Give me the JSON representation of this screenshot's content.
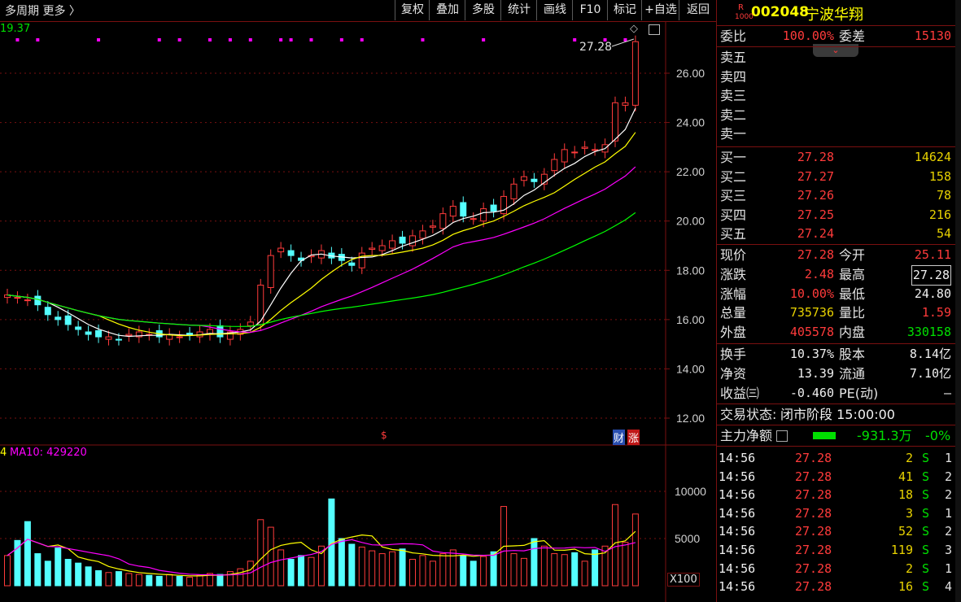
{
  "toolbar": {
    "period_label": "多周期  更多 〉",
    "buttons": [
      "复权",
      "叠加",
      "多股",
      "统计",
      "画线",
      "F10",
      "标记",
      "+自选",
      "返回"
    ]
  },
  "stock": {
    "badge_top": "R",
    "badge_bottom": "1000",
    "code": "002048",
    "name": "宁波华翔"
  },
  "chart": {
    "top_left_value": "19.37",
    "price_ticks": [
      "26.00",
      "24.00",
      "22.00",
      "20.00",
      "18.00",
      "16.00",
      "14.00",
      "12.00"
    ],
    "latest_label": "27.28",
    "vol_legend_a": "4",
    "vol_legend_b": "MA10: 429220",
    "vol_ticks": [
      "10000",
      "5000"
    ],
    "vol_unit": "X100",
    "marker_fin": "财",
    "marker_rise": "涨",
    "marker_dollar": "$"
  },
  "chart_data": {
    "type": "candlestick",
    "y_range": [
      11.5,
      27.8
    ],
    "closes": [
      17.0,
      16.9,
      16.8,
      16.6,
      16.2,
      16.0,
      15.8,
      15.6,
      15.4,
      15.3,
      15.3,
      15.2,
      15.4,
      15.5,
      15.4,
      15.3,
      15.4,
      15.3,
      15.4,
      15.5,
      15.6,
      15.3,
      15.5,
      15.6,
      15.9,
      17.4,
      18.6,
      18.9,
      18.6,
      18.4,
      18.6,
      18.8,
      18.5,
      18.4,
      18.2,
      18.7,
      18.9,
      19.0,
      19.2,
      19.1,
      19.4,
      19.6,
      19.8,
      20.3,
      20.6,
      20.2,
      20.1,
      20.5,
      20.4,
      21.0,
      21.5,
      21.8,
      21.6,
      21.9,
      22.5,
      22.9,
      22.8,
      23.0,
      22.9,
      23.1,
      24.8,
      24.8,
      27.28
    ],
    "volumes": [
      3200,
      4800,
      6800,
      3400,
      2600,
      4000,
      2800,
      2400,
      2000,
      1600,
      1400,
      1500,
      1300,
      1200,
      1100,
      1000,
      1200,
      1000,
      900,
      1100,
      1300,
      1200,
      1500,
      1800,
      2600,
      7000,
      6200,
      3800,
      2800,
      3200,
      3000,
      4200,
      9200,
      5000,
      4400,
      4100,
      3700,
      3400,
      3600,
      3900,
      2800,
      3200,
      2600,
      3400,
      3800,
      3200,
      2600,
      3100,
      3600,
      8400,
      3400,
      2900,
      5000,
      4200,
      3400,
      3300,
      3500,
      2600,
      3800,
      4200,
      8600,
      4600,
      7600
    ],
    "price_ticks": [
      26,
      24,
      22,
      20,
      18,
      16,
      14,
      12
    ],
    "volume_ticks": [
      10000,
      5000
    ]
  },
  "order_book": {
    "weibi_label": "委比",
    "weibi_value": "100.00%",
    "weicha_label": "委差",
    "weicha_value": "15130",
    "sell": [
      {
        "label": "卖五"
      },
      {
        "label": "卖四"
      },
      {
        "label": "卖三"
      },
      {
        "label": "卖二"
      },
      {
        "label": "卖一"
      }
    ],
    "buy": [
      {
        "label": "买一",
        "price": "27.28",
        "vol": "14624"
      },
      {
        "label": "买二",
        "price": "27.27",
        "vol": "158"
      },
      {
        "label": "买三",
        "price": "27.26",
        "vol": "78"
      },
      {
        "label": "买四",
        "price": "27.25",
        "vol": "216"
      },
      {
        "label": "买五",
        "price": "27.24",
        "vol": "54"
      }
    ]
  },
  "quote": {
    "rows": [
      {
        "l1": "现价",
        "v1": "27.28",
        "l2": "今开",
        "v2": "25.11"
      },
      {
        "l1": "涨跌",
        "v1": "2.48",
        "l2": "最高",
        "v2": "27.28"
      },
      {
        "l1": "涨幅",
        "v1": "10.00%",
        "l2": "最低",
        "v2": "24.80"
      },
      {
        "l1": "总量",
        "v1": "735736",
        "l2": "量比",
        "v2": "1.59"
      },
      {
        "l1": "外盘",
        "v1": "405578",
        "l2": "内盘",
        "v2": "330158"
      }
    ],
    "rows2": [
      {
        "l1": "换手",
        "v1": "10.37%",
        "l2": "股本",
        "v2": "8.14亿"
      },
      {
        "l1": "净资",
        "v1": "13.39",
        "l2": "流通",
        "v2": "7.10亿"
      },
      {
        "l1": "收益㈢",
        "v1": "-0.460",
        "l2": "PE(动)",
        "v2": "–"
      }
    ]
  },
  "status": {
    "label": "交易状态:",
    "value": "闭市阶段 15:00:00"
  },
  "flow": {
    "label": "主力净额",
    "value": "-931.3万",
    "pct": "-0%"
  },
  "ticks": [
    {
      "time": "14:56",
      "price": "27.28",
      "vol": "2",
      "side": "S",
      "n": "1"
    },
    {
      "time": "14:56",
      "price": "27.28",
      "vol": "41",
      "side": "S",
      "n": "2"
    },
    {
      "time": "14:56",
      "price": "27.28",
      "vol": "18",
      "side": "S",
      "n": "2"
    },
    {
      "time": "14:56",
      "price": "27.28",
      "vol": "3",
      "side": "S",
      "n": "1"
    },
    {
      "time": "14:56",
      "price": "27.28",
      "vol": "52",
      "side": "S",
      "n": "2"
    },
    {
      "time": "14:56",
      "price": "27.28",
      "vol": "119",
      "side": "S",
      "n": "3"
    },
    {
      "time": "14:56",
      "price": "27.28",
      "vol": "2",
      "side": "S",
      "n": "1"
    },
    {
      "time": "14:56",
      "price": "27.28",
      "vol": "16",
      "side": "S",
      "n": "4"
    }
  ],
  "colors": {
    "up": "#ff3b3b",
    "down": "#54ffff",
    "ma5": "#ffffff",
    "ma10": "#ffff00",
    "ma20": "#ff00ff",
    "ma60": "#00ff00",
    "grid": "#7a1010"
  }
}
